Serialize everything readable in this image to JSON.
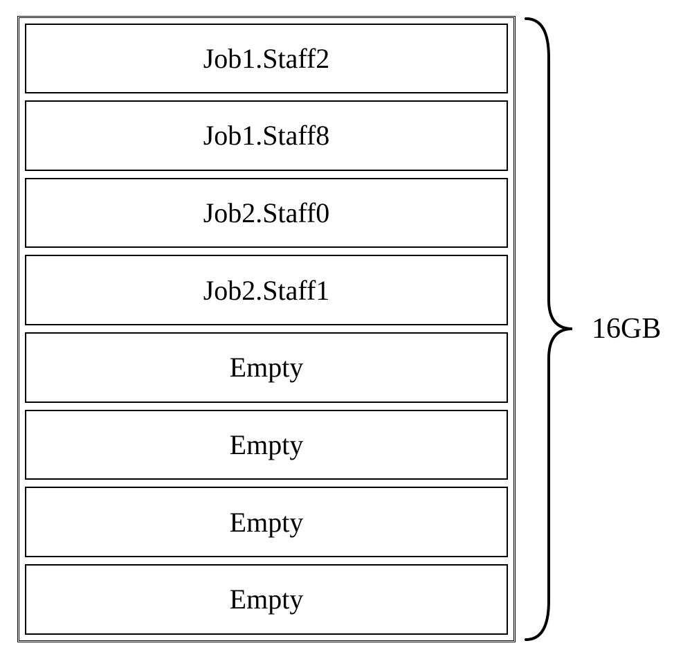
{
  "diagram": {
    "slots": [
      {
        "label": "Job1.Staff2"
      },
      {
        "label": "Job1.Staff8"
      },
      {
        "label": "Job2.Staff0"
      },
      {
        "label": "Job2.Staff1"
      },
      {
        "label": "Empty"
      },
      {
        "label": "Empty"
      },
      {
        "label": "Empty"
      },
      {
        "label": "Empty"
      }
    ],
    "total_size_label": "16GB"
  }
}
